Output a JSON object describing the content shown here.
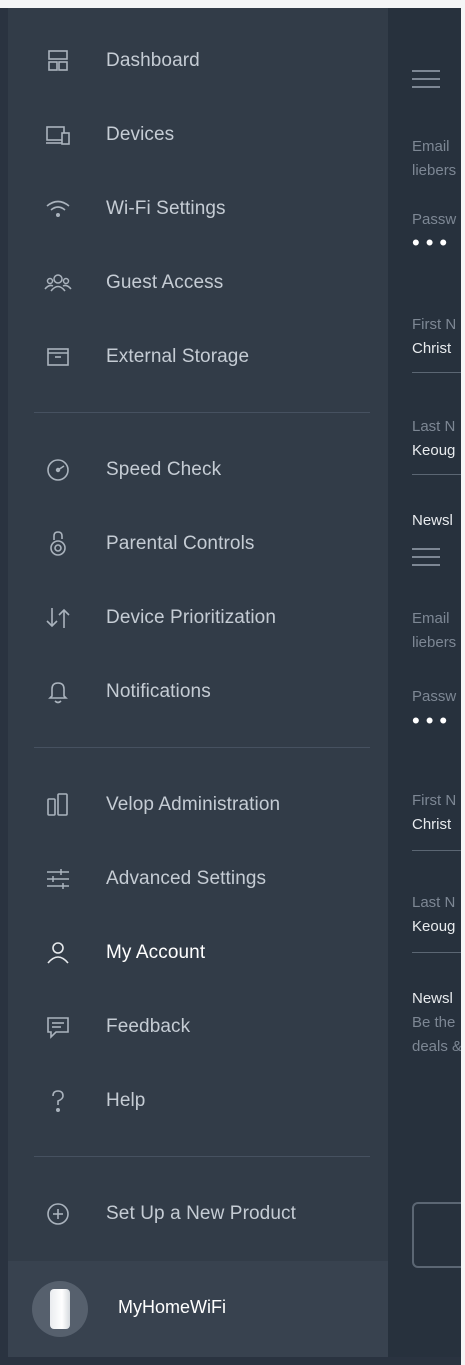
{
  "sidebar": {
    "groups": [
      [
        {
          "label": "Dashboard",
          "icon": "dashboard-icon"
        },
        {
          "label": "Devices",
          "icon": "devices-icon"
        },
        {
          "label": "Wi-Fi Settings",
          "icon": "wifi-icon"
        },
        {
          "label": "Guest Access",
          "icon": "guest-access-icon"
        },
        {
          "label": "External Storage",
          "icon": "external-storage-icon"
        }
      ],
      [
        {
          "label": "Speed Check",
          "icon": "speedometer-icon"
        },
        {
          "label": "Parental Controls",
          "icon": "parental-controls-icon"
        },
        {
          "label": "Device Prioritization",
          "icon": "prioritization-arrows-icon"
        },
        {
          "label": "Notifications",
          "icon": "bell-icon"
        }
      ],
      [
        {
          "label": "Velop Administration",
          "icon": "velop-nodes-icon"
        },
        {
          "label": "Advanced Settings",
          "icon": "sliders-icon"
        },
        {
          "label": "My Account",
          "icon": "user-icon",
          "active": true
        },
        {
          "label": "Feedback",
          "icon": "chat-bubble-icon"
        },
        {
          "label": "Help",
          "icon": "question-mark-icon"
        }
      ],
      [
        {
          "label": "Set Up a New Product",
          "icon": "plus-circle-icon"
        }
      ]
    ]
  },
  "footer": {
    "network_name": "MyHomeWiFi"
  },
  "panel": {
    "top": {
      "email_label": "Email",
      "email_value": "liebers",
      "password_label": "Passw",
      "password_value": "•••",
      "first_name_label": "First N",
      "first_name_value": "Christ",
      "last_name_label": "Last N",
      "last_name_value": "Keoug",
      "newsletter_label": "Newsl"
    },
    "bottom": {
      "email_label": "Email",
      "email_value": "liebers",
      "password_label": "Passw",
      "password_value": "•••",
      "first_name_label": "First N",
      "first_name_value": "Christ",
      "last_name_label": "Last N",
      "last_name_value": "Keoug",
      "newsletter_label": "Newsl",
      "newsletter_desc_1": "Be the",
      "newsletter_desc_2": "deals &"
    }
  },
  "colors": {
    "sidebar_bg": "#323c48",
    "panel_bg": "#27313d",
    "text_active": "#ffffff",
    "text_default": "#c5ccd4"
  }
}
